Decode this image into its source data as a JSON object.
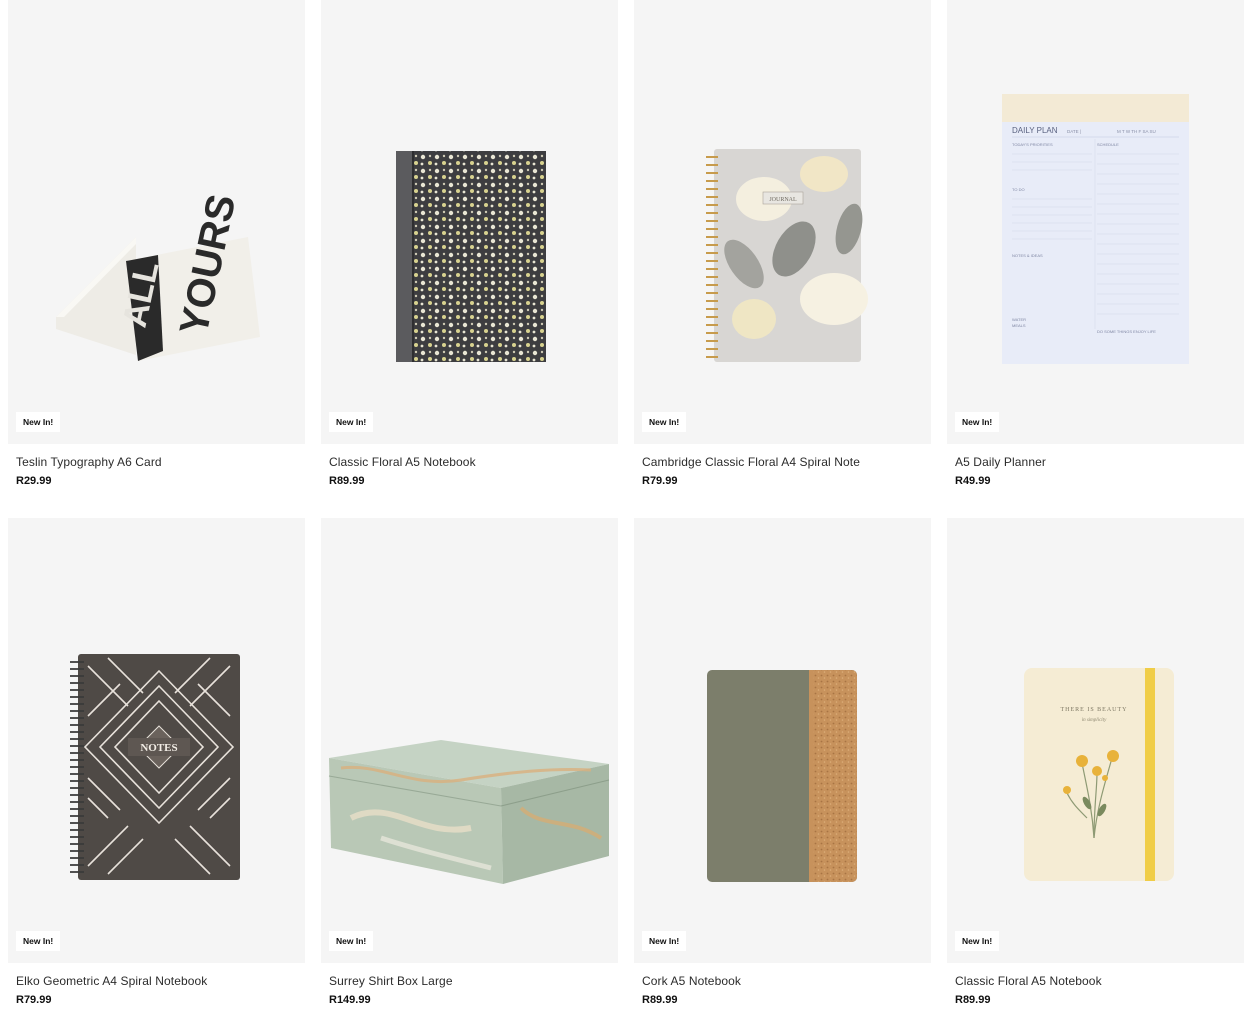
{
  "products": [
    {
      "title": "Teslin Typography A6 Card",
      "price": "R29.99",
      "badge": "New In!",
      "image": "typography-card-image"
    },
    {
      "title": "Classic Floral A5 Notebook",
      "price": "R89.99",
      "badge": "New In!",
      "image": "floral-notebook-image"
    },
    {
      "title": "Cambridge Classic Floral A4 Spiral Note",
      "price": "R79.99",
      "badge": "New In!",
      "image": "spiral-journal-image"
    },
    {
      "title": "A5 Daily Planner",
      "price": "R49.99",
      "badge": "New In!",
      "image": "daily-planner-image"
    },
    {
      "title": "Elko Geometric A4 Spiral Notebook",
      "price": "R79.99",
      "badge": "New In!",
      "image": "geometric-notebook-image"
    },
    {
      "title": "Surrey Shirt Box Large",
      "price": "R149.99",
      "badge": "New In!",
      "image": "marble-box-image"
    },
    {
      "title": "Cork A5 Notebook",
      "price": "R89.99",
      "badge": "New In!",
      "image": "cork-notebook-image"
    },
    {
      "title": "Classic Floral A5 Notebook",
      "price": "R89.99",
      "badge": "New In!",
      "image": "floral-yellow-notebook-image"
    }
  ],
  "art_text": {
    "card_word_1": "ALL",
    "card_word_2": "YOURS",
    "journal_label": "JOURNAL",
    "planner_title": "DAILY PLAN",
    "planner_date": "DATE |",
    "planner_days": "M  T  W  TH  F  SA  SU",
    "planner_priorities": "TODAY'S PRIORITIES",
    "planner_schedule": "SCHEDULE",
    "planner_todo": "TO DO",
    "planner_notes": "NOTES & IDEAS",
    "planner_water": "WATER",
    "planner_meals": "MEALS",
    "planner_footer": "DO SOME THINGS ENJOY LIFE",
    "notes_label": "NOTES",
    "beauty_label": "THERE IS BEAUTY",
    "beauty_sub": "in simplicity"
  },
  "colors": {
    "card_bg": "#f5f5f5",
    "badge_bg": "#ffffff"
  }
}
